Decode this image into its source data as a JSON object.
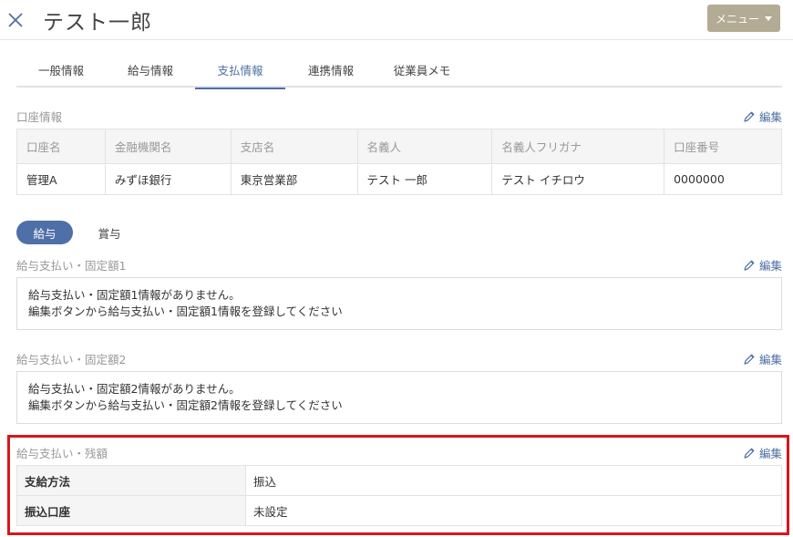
{
  "header": {
    "title": "テスト一郎",
    "close_icon": "close-x-icon",
    "menu_label": "メニュー",
    "menu_button_color": "#b3ab93"
  },
  "tabs": [
    {
      "label": "一般情報",
      "active": false
    },
    {
      "label": "給与情報",
      "active": false
    },
    {
      "label": "支払情報",
      "active": true
    },
    {
      "label": "連携情報",
      "active": false
    },
    {
      "label": "従業員メモ",
      "active": false
    }
  ],
  "accent_color": "#4d6fa3",
  "edit_label": "編集",
  "account": {
    "title": "口座情報",
    "headers": [
      "口座名",
      "金融機関名",
      "支店名",
      "名義人",
      "名義人フリガナ",
      "口座番号"
    ],
    "rows": [
      [
        "管理A",
        "みずほ銀行",
        "東京営業部",
        "テスト 一郎",
        "テスト イチロウ",
        "0000000"
      ]
    ]
  },
  "pay_tabs": {
    "salary": "給与",
    "bonus": "賞与"
  },
  "fixed1": {
    "title": "給与支払い・固定額1",
    "line1": "給与支払い・固定額1情報がありません。",
    "line2": "編集ボタンから給与支払い・固定額1情報を登録してください"
  },
  "fixed2": {
    "title": "給与支払い・固定額2",
    "line1": "給与支払い・固定額2情報がありません。",
    "line2": "編集ボタンから給与支払い・固定額2情報を登録してください"
  },
  "remainder": {
    "title": "給与支払い・残額",
    "method_label": "支給方法",
    "method_value": "振込",
    "account_label": "振込口座",
    "account_value": "未設定",
    "highlight_color": "#d8151f"
  }
}
